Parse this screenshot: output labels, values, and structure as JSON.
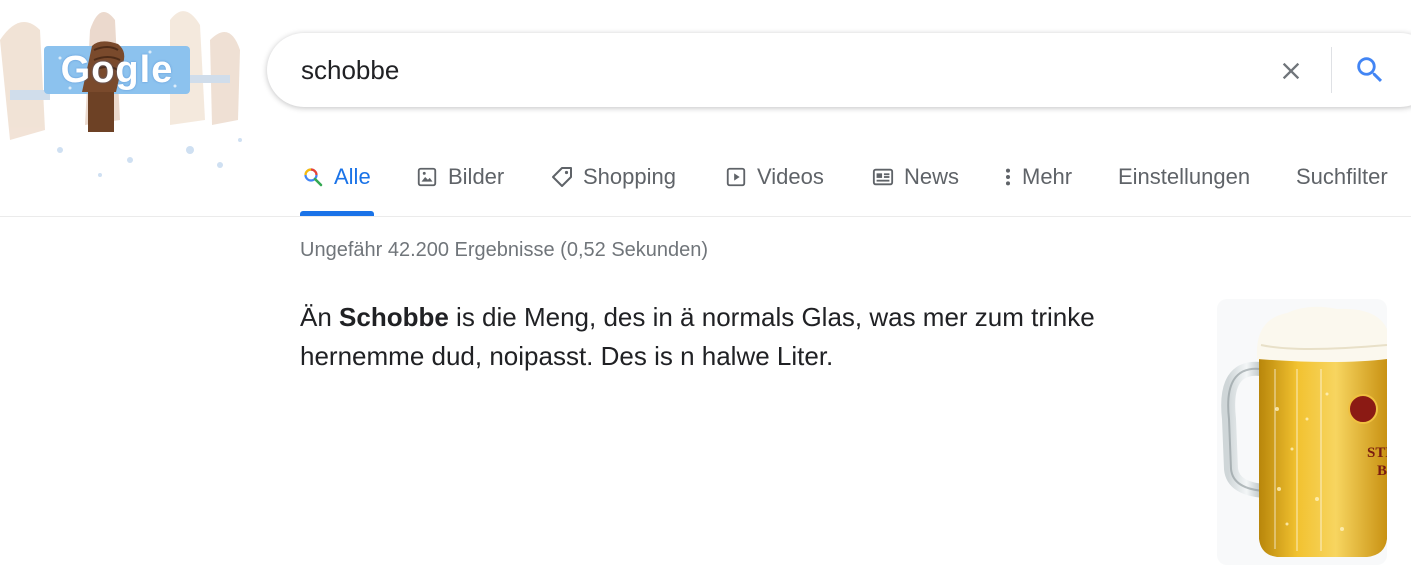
{
  "logo": {
    "text": "Gogle"
  },
  "search": {
    "query": "schobbe",
    "clear_label": "✕"
  },
  "tabs": [
    {
      "label": "Alle",
      "icon": "search-icon",
      "active": true
    },
    {
      "label": "Bilder",
      "icon": "image-icon"
    },
    {
      "label": "Shopping",
      "icon": "tag-icon"
    },
    {
      "label": "Videos",
      "icon": "play-icon"
    },
    {
      "label": "News",
      "icon": "news-icon"
    },
    {
      "label": "Mehr",
      "icon": "more-vert-icon"
    },
    {
      "label": "Einstellungen"
    },
    {
      "label": "Suchfilter"
    }
  ],
  "stats": "Ungefähr 42.200 Ergebnisse (0,52 Sekunden)",
  "snippet": {
    "prefix": "Än ",
    "bold": "Schobbe",
    "suffix": " is die Meng, des in ä normals Glas, was mer zum trinke hernemme dud, noipasst. Des is n halwe Liter."
  },
  "image": {
    "label_line1": "STEIN",
    "label_line2": "BIER"
  },
  "colors": {
    "accent": "#1a73e8",
    "muted": "#5f6368",
    "stats": "#70757a"
  }
}
